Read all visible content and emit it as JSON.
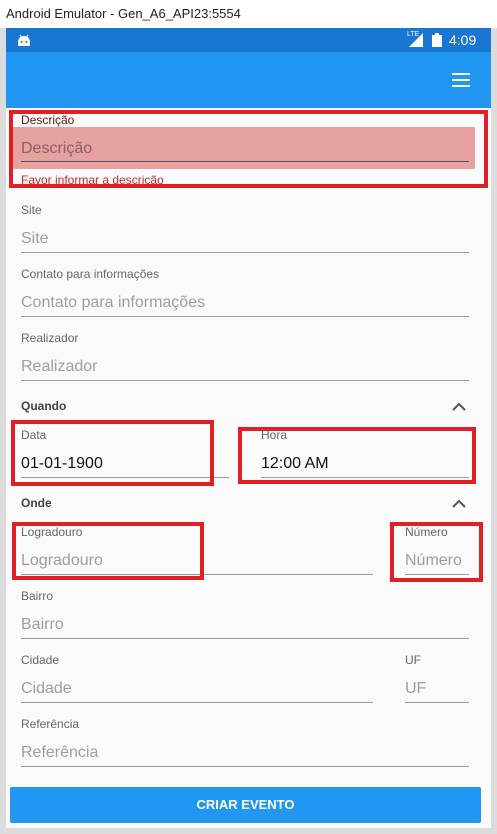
{
  "window": {
    "title": "Android Emulator - Gen_A6_API23:5554"
  },
  "statusbar": {
    "time": "4:09",
    "network": "LTE"
  },
  "form": {
    "descricao": {
      "label": "Descrição",
      "placeholder": "Descrição",
      "error": "Favor informar a descrição"
    },
    "site": {
      "label": "Site",
      "placeholder": "Site"
    },
    "contato": {
      "label": "Contato para informações",
      "placeholder": "Contato para informações"
    },
    "realizador": {
      "label": "Realizador",
      "placeholder": "Realizador"
    },
    "quando": {
      "title": "Quando",
      "data": {
        "label": "Data",
        "value": "01-01-1900"
      },
      "hora": {
        "label": "Hora",
        "value": "12:00 AM"
      }
    },
    "onde": {
      "title": "Onde",
      "logradouro": {
        "label": "Logradouro",
        "placeholder": "Logradouro"
      },
      "numero": {
        "label": "Número",
        "placeholder": "Número"
      },
      "bairro": {
        "label": "Bairro",
        "placeholder": "Bairro"
      },
      "cidade": {
        "label": "Cidade",
        "placeholder": "Cidade"
      },
      "uf": {
        "label": "UF",
        "placeholder": "UF"
      },
      "referencia": {
        "label": "Referência",
        "placeholder": "Referência"
      }
    },
    "submit_label": "CRIAR EVENTO"
  },
  "colors": {
    "primary": "#2196F3",
    "primary_dark": "#1976D2",
    "error": "#C62828",
    "highlight": "#E01F26"
  },
  "icons": [
    "android-icon",
    "lte-signal-icon",
    "battery-icon",
    "menu-icon",
    "chevron-up-icon"
  ]
}
